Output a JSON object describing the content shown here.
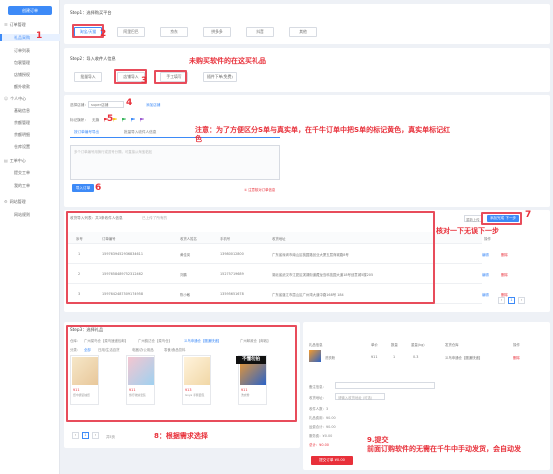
{
  "sidebar": {
    "top_button": "创建订单",
    "groups": [
      {
        "label": "订单管理",
        "items": [
          "礼品采购",
          "订单列表",
          "包裹管理",
          "店铺授权",
          "额外收款"
        ]
      },
      {
        "label": "个人中心",
        "items": [
          "基础信息",
          "余额管理",
          "余额明细",
          "仓库设置"
        ]
      },
      {
        "label": "工单中心",
        "items": [
          "提交工单",
          "我的工单"
        ]
      },
      {
        "label": "网站管理",
        "items": [
          "网站规则"
        ]
      }
    ]
  },
  "step1": {
    "title": "Step1：选择购买平台",
    "platforms": [
      "淘宝/天猫",
      "阿里巴巴",
      "京东",
      "拼多多",
      "抖音",
      "其他"
    ]
  },
  "step2": {
    "title": "Step2：导入收件人信息",
    "options": [
      "批量导入",
      "店铺导入",
      "手工填写",
      "插件下单(免费)"
    ]
  },
  "shop_area": {
    "shop_label": "选择店铺：",
    "shop_value": "super店铺",
    "add_shop": "添加店铺",
    "flag_label": "标记旗帜：",
    "flag_none": "无旗",
    "tab_pay": "按订单编号导出",
    "tab_batch": "批量导入收件人信息",
    "textarea_placeholder": "多个订单编号用换行或逗号分隔，可直接从淘宝粘贴",
    "import_button": "导入订单",
    "import_hint": "① 注意核对订单信息"
  },
  "table": {
    "header": "收货导入列表：共3条收件人信息",
    "header_tip": "已上传了所有的",
    "btn_clear": "重新上传",
    "btn_next": "添加完成 下一步",
    "columns": [
      "序号",
      "订单编号",
      "收货人姓名",
      "手机号",
      "收货地址",
      "操作"
    ],
    "rows": [
      {
        "no": "1",
        "order": "1597639452936834611",
        "name": "黄佳岚",
        "phone": "13980012800",
        "addr": "广东省深圳市南山区桃园路创业大厦五层商城路8号",
        "edit": "编辑",
        "del": "删除"
      },
      {
        "no": "2",
        "order": "1597658489752312462",
        "name": "刘鹏",
        "phone": "15275719689",
        "addr": "湖北省武汉市江夏区滨湖街道藏龙岛科技园大道18号创意城5楼205",
        "edit": "编辑",
        "del": "删除"
      },
      {
        "no": "3",
        "order": "1597642487509174958",
        "name": "陈小敏",
        "phone": "13595651678",
        "addr": "广东省湛江市霞山区广州湾大道中路168号  184",
        "edit": "编辑",
        "del": "删除"
      }
    ],
    "page": "1"
  },
  "step3": {
    "title": "Step3：选择礼品",
    "warehouse_label": "仓库：",
    "warehouses": [
      "广州菜鸟仓【菜鸟速递包邮】",
      "广州韵达仓【菜鸟仓】",
      "义乌申通仓【圆通快递】",
      "广州邮政仓【邮政】"
    ],
    "cat_label": "分类：",
    "categories": [
      "全部",
      "日用/生活百货",
      "电器/办公用品",
      "零食/食品饮料"
    ],
    "products": [
      {
        "price": "¥11",
        "name": "纸巾袋装抽纸"
      },
      {
        "price": "¥11",
        "name": "旅行收纳套装"
      },
      {
        "price": "¥13",
        "name": "Goya 手撕面包"
      },
      {
        "price": "¥11",
        "name": "洗衣粉"
      }
    ],
    "product_overlay": "不懂勿拍",
    "page": "1",
    "page_total": "共5页"
  },
  "gift_summary": {
    "columns": [
      "礼品信息",
      "单价",
      "数量",
      "重量(kg)",
      "发货仓库",
      "操作"
    ],
    "item_name": "洗衣粉",
    "item_price": "¥11",
    "item_qty": "1",
    "item_weight": "0.3",
    "item_wh": "义乌申通仓【圆通快递】",
    "item_del": "删除",
    "note_label": "备注信息：",
    "receive_label": "收货地址：",
    "receive_value": "请输入收货地址 (可选)",
    "fee_labels": [
      "收件人数：3",
      "礼品费用：¥0.00",
      "运费合计：¥0.00",
      "服务费：¥0.00",
      "总计：¥0.00"
    ],
    "submit": "提交订单  ¥0.00"
  },
  "annotations": {
    "n1": "1",
    "n2": "2",
    "n3": "3",
    "n4": "4",
    "n5": "5",
    "n6": "6",
    "n7": "7",
    "gift_note": "未购买软件的在这买礼品",
    "flag_note": "注意：为了方便区分S单与真实单，在千牛订单中把S单的标记黄色，真实单标记红色",
    "verify_note": "核对一下无误下一步",
    "n8_note": "8：根据需求选择",
    "submit_note": "9.提交\n前面订购软件的无需在千牛中手动发货，会自动发"
  },
  "colors": {
    "accent": "#3d8af7",
    "annotation_red": "#e8303a",
    "flag_yellow": "#f5c518"
  }
}
